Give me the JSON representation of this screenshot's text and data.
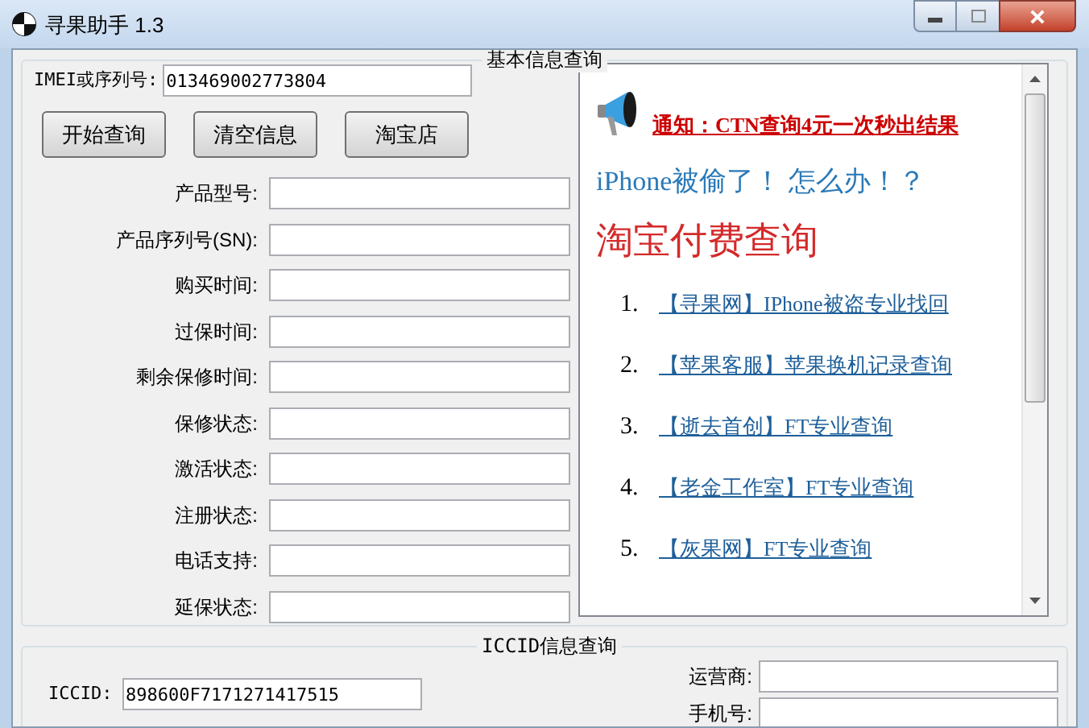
{
  "window": {
    "title": "寻果助手 1.3"
  },
  "basic_group": {
    "title": "基本信息查询",
    "imei": {
      "label": "IMEI或序列号:",
      "value": "013469002773804"
    },
    "buttons": [
      "开始查询",
      "清空信息",
      "淘宝店"
    ],
    "fields": [
      {
        "label": "产品型号:"
      },
      {
        "label": "产品序列号(SN):"
      },
      {
        "label": "购买时间:"
      },
      {
        "label": "过保时间:"
      },
      {
        "label": "剩余保修时间:"
      },
      {
        "label": "保修状态:"
      },
      {
        "label": "激活状态:"
      },
      {
        "label": "注册状态:"
      },
      {
        "label": "电话支持:"
      },
      {
        "label": "延保状态:"
      }
    ]
  },
  "browser": {
    "notice": "通知：CTN查询4元一次秒出结果",
    "question": "iPhone被偷了！ 怎么办！？",
    "heading": "淘宝付费查询",
    "links": [
      {
        "number": "1.",
        "text": "【寻果网】IPhone被盗专业找回"
      },
      {
        "number": "2.",
        "text": "【苹果客服】苹果换机记录查询"
      },
      {
        "number": "3.",
        "text": "【逝去首创】FT专业查询"
      },
      {
        "number": "4.",
        "text": "【老金工作室】FT专业查询"
      },
      {
        "number": "5.",
        "text": "【灰果网】FT专业查询"
      }
    ]
  },
  "iccid_group": {
    "title": "ICCID信息查询",
    "iccid": {
      "label": "ICCID:",
      "value": "898600F7171271417515"
    },
    "fields": [
      {
        "label": "运营商:"
      },
      {
        "label": "手机号:"
      }
    ]
  }
}
